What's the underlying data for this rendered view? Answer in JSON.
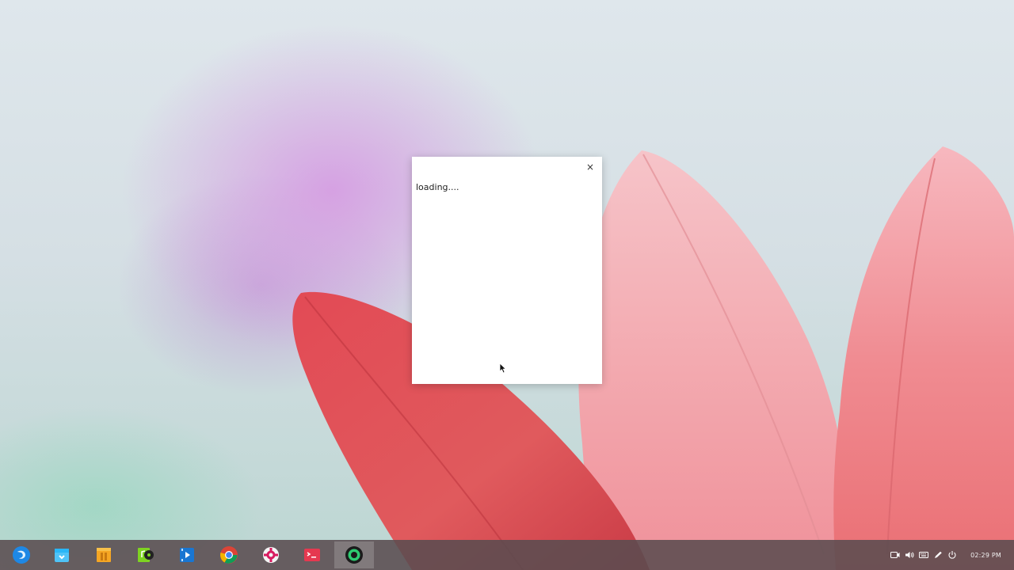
{
  "dialog": {
    "close_glyph": "×",
    "status_text": "loading...."
  },
  "taskbar": {
    "dock": [
      {
        "name": "launcher-icon",
        "color": "#1e88e5"
      },
      {
        "name": "app-store-icon",
        "color": "#4fc3f7"
      },
      {
        "name": "file-manager-icon",
        "color": "#f5a623"
      },
      {
        "name": "music-player-icon",
        "color": "#7ed321"
      },
      {
        "name": "movie-player-icon",
        "color": "#1976d2"
      },
      {
        "name": "chrome-browser-icon",
        "color": "#db4437"
      },
      {
        "name": "settings-gear-icon",
        "color": "#d81b60"
      },
      {
        "name": "terminal-icon",
        "color": "#e53950"
      },
      {
        "name": "screen-recorder-icon",
        "color": "#2ecc71"
      }
    ],
    "tray": {
      "icons": [
        "camera-icon",
        "volume-icon",
        "keyboard-icon",
        "pen-icon",
        "power-icon"
      ],
      "clock": "02:29 PM"
    }
  }
}
